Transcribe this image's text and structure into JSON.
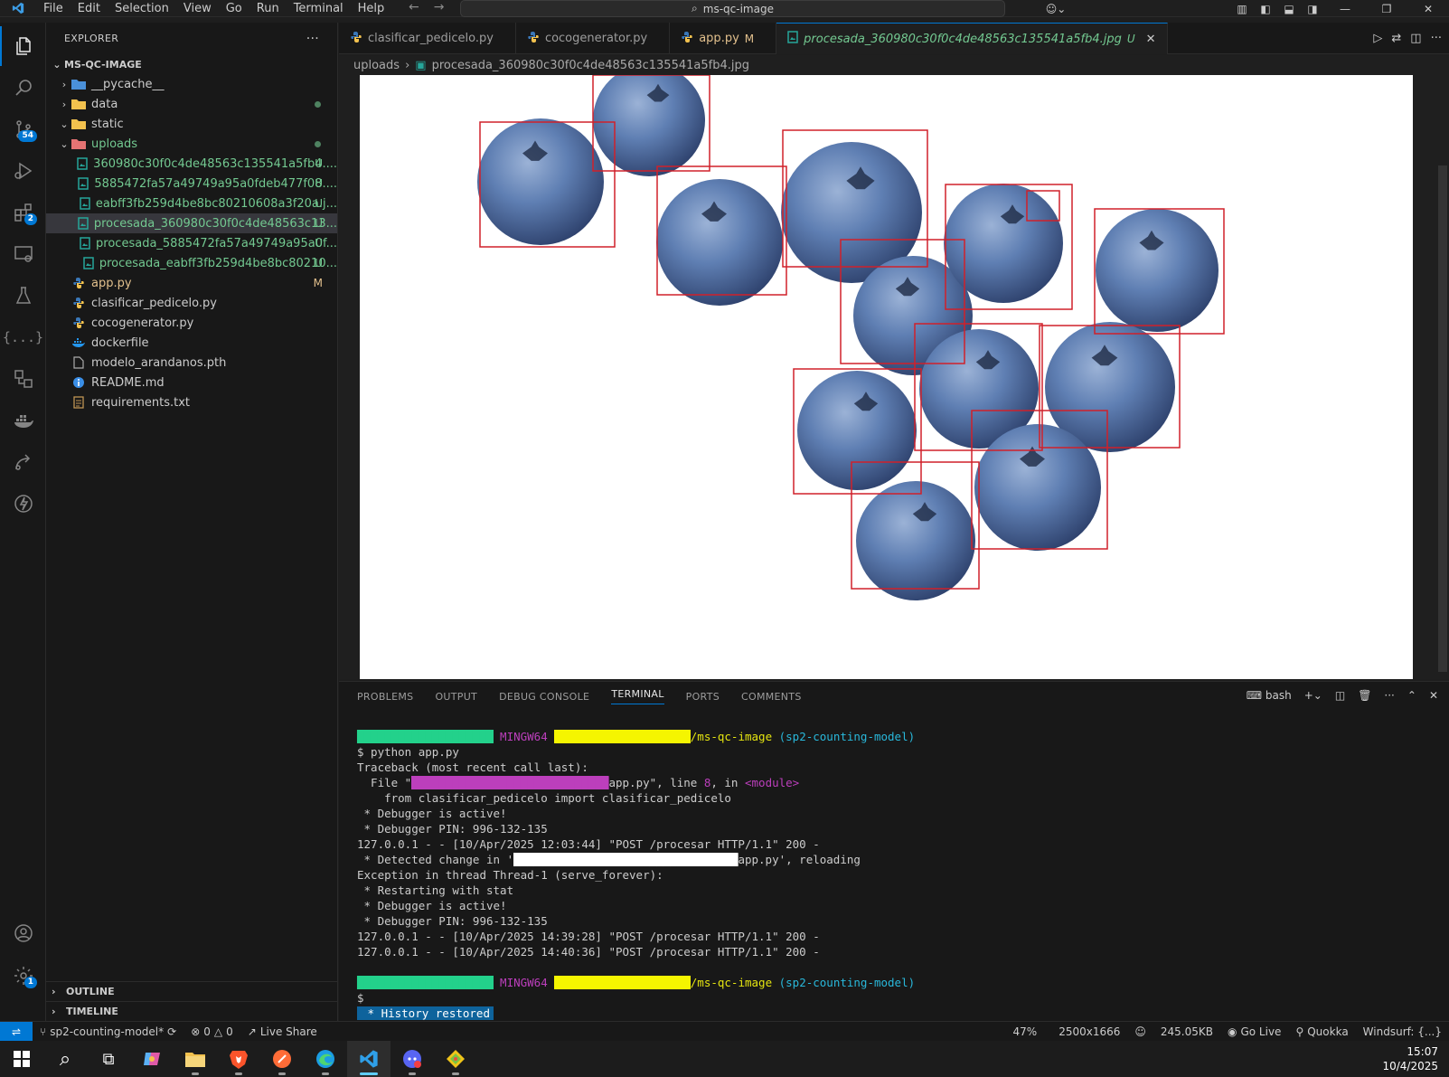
{
  "menu": [
    "File",
    "Edit",
    "Selection",
    "View",
    "Go",
    "Run",
    "Terminal",
    "Help"
  ],
  "command_center": "ms-qc-image",
  "explorer": {
    "header": "EXPLORER",
    "root": "MS-QC-IMAGE",
    "items": [
      {
        "label": "__pycache__",
        "type": "folder",
        "indent": 1,
        "expanded": false
      },
      {
        "label": "data",
        "type": "folder",
        "indent": 1,
        "expanded": false,
        "status": "dot"
      },
      {
        "label": "static",
        "type": "folder",
        "indent": 1,
        "expanded": true
      },
      {
        "label": "uploads",
        "type": "folder",
        "indent": 1,
        "expanded": true,
        "status": "dot",
        "color": "green"
      },
      {
        "label": "360980c30f0c4de48563c135541a5fb4....",
        "type": "image",
        "indent": 2,
        "status": "U",
        "color": "green"
      },
      {
        "label": "5885472fa57a49749a95a0fdeb477f08....",
        "type": "image",
        "indent": 2,
        "status": "U",
        "color": "green"
      },
      {
        "label": "eabff3fb259d4be8bc80210608a3f20a.j...",
        "type": "image",
        "indent": 2,
        "status": "U",
        "color": "green"
      },
      {
        "label": "procesada_360980c30f0c4de48563c13...",
        "type": "image",
        "indent": 2,
        "status": "U",
        "color": "green",
        "selected": true
      },
      {
        "label": "procesada_5885472fa57a49749a95a0f...",
        "type": "image",
        "indent": 2,
        "status": "U",
        "color": "green"
      },
      {
        "label": "procesada_eabff3fb259d4be8bc80210...",
        "type": "image",
        "indent": 2,
        "status": "U",
        "color": "green"
      },
      {
        "label": "app.py",
        "type": "python",
        "indent": 1,
        "status": "M",
        "color": "orange"
      },
      {
        "label": "clasificar_pedicelo.py",
        "type": "python",
        "indent": 1
      },
      {
        "label": "cocogenerator.py",
        "type": "python",
        "indent": 1
      },
      {
        "label": "dockerfile",
        "type": "docker",
        "indent": 1
      },
      {
        "label": "modelo_arandanos.pth",
        "type": "file",
        "indent": 1
      },
      {
        "label": "README.md",
        "type": "info",
        "indent": 1
      },
      {
        "label": "requirements.txt",
        "type": "text",
        "indent": 1
      }
    ],
    "outline": "OUTLINE",
    "timeline": "TIMELINE"
  },
  "tabs": [
    {
      "label": "clasificar_pedicelo.py",
      "icon": "python-icon"
    },
    {
      "label": "cocogenerator.py",
      "icon": "python-icon"
    },
    {
      "label": "app.py",
      "icon": "python-icon",
      "status": "M"
    },
    {
      "label": "procesada_360980c30f0c4de48563c135541a5fb4.jpg",
      "icon": "image-icon",
      "status": "U",
      "active": true
    }
  ],
  "breadcrumb": {
    "folder": "uploads",
    "file": "procesada_360980c30f0c4de48563c135541a5fb4.jpg"
  },
  "panel": {
    "tabs": [
      "PROBLEMS",
      "OUTPUT",
      "DEBUG CONSOLE",
      "TERMINAL",
      "PORTS",
      "COMMENTS"
    ],
    "active_tab": "TERMINAL",
    "shell": "bash"
  },
  "terminal": {
    "prompt_env": "MINGW64",
    "prompt_path_suffix": "/ms-qc-image",
    "prompt_branch": "(sp2-counting-model)",
    "lines": [
      "$ python app.py",
      "Traceback (most recent call last):",
      "  File \"",
      "app.py\", line ",
      "8",
      ", in ",
      "<module>",
      "    from clasificar_pedicelo import clasificar_pedicelo",
      " * Debugger is active!",
      " * Debugger PIN: 996-132-135",
      "127.0.0.1 - - [10/Apr/2025 12:03:44] \"POST /procesar HTTP/1.1\" 200 -",
      " * Detected change in '",
      "app.py', reloading",
      "Exception in thread Thread-1 (serve_forever):",
      " * Restarting with stat",
      " * Debugger is active!",
      " * Debugger PIN: 996-132-135",
      "127.0.0.1 - - [10/Apr/2025 14:39:28] \"POST /procesar HTTP/1.1\" 200 -",
      "127.0.0.1 - - [10/Apr/2025 14:40:36] \"POST /procesar HTTP/1.1\" 200 -",
      "$ ",
      "History restored"
    ]
  },
  "statusbar": {
    "branch": "sp2-counting-model*",
    "errors": "0",
    "warnings": "0",
    "live_share": "Live Share",
    "zoom": "47%",
    "dimensions": "2500x1666",
    "size": "245.05KB",
    "go_live": "Go Live",
    "quokka": "Quokka",
    "windsurf": "Windsurf: {...}"
  },
  "activity_badges": {
    "source_control": "54",
    "extensions": "2",
    "settings": "1"
  },
  "taskbar": {
    "time": "15:07",
    "date": "10/4/2025"
  },
  "image": {
    "subject": "blueberries with detection boxes",
    "box_color": "#d0202a"
  }
}
